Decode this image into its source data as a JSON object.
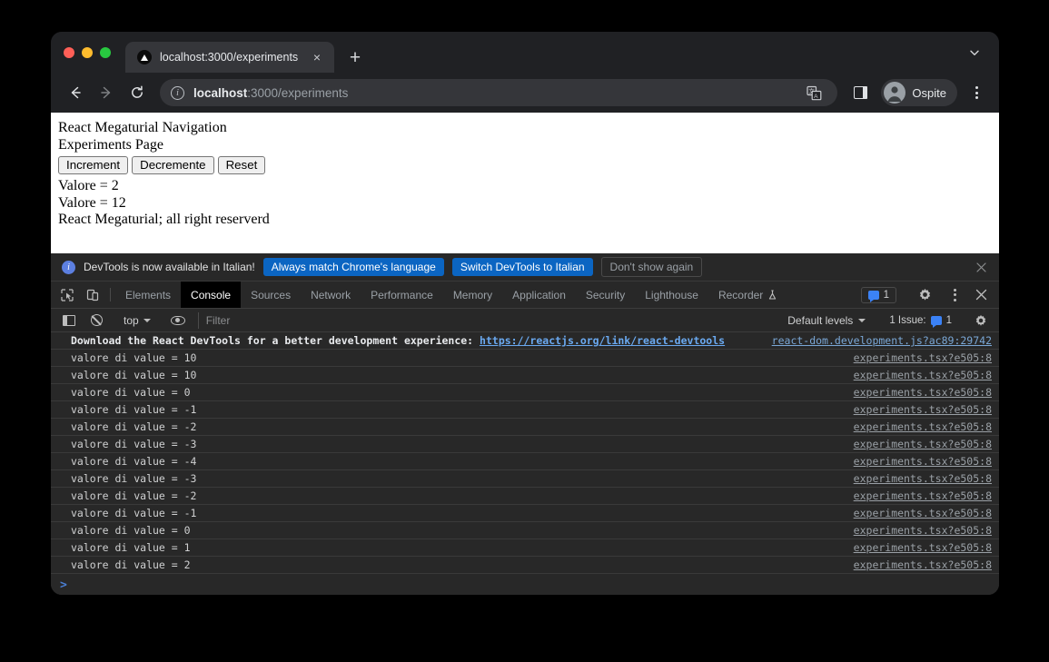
{
  "browser": {
    "tab": {
      "title": "localhost:3000/experiments",
      "favicon": "nextjs-triangle-icon",
      "close_label": "×"
    },
    "new_tab_label": "+",
    "tab_list_icon": "chevron-down-icon",
    "nav": {
      "back": "←",
      "forward": "→",
      "reload": "⟳"
    },
    "omnibox": {
      "site_info_icon": "info-icon",
      "url_host": "localhost",
      "url_rest": ":3000/experiments",
      "full_url": "localhost:3000/experiments"
    },
    "translate_icon": "translate-icon",
    "side_panel_icon": "side-panel-icon",
    "profile": {
      "name": "Ospite",
      "avatar_icon": "person-avatar-icon"
    },
    "menu_icon": "kebab-menu-icon"
  },
  "page": {
    "heading": "React Megaturial Navigation",
    "subheading": "Experiments Page",
    "buttons": [
      {
        "label": "Increment"
      },
      {
        "label": "Decremente"
      },
      {
        "label": "Reset"
      }
    ],
    "values": [
      "Valore = 2",
      "Valore = 12"
    ],
    "footer": "React Megaturial; all right reserverd"
  },
  "devtools": {
    "banner": {
      "icon": "info-icon",
      "text": "DevTools is now available in Italian!",
      "primary_button": "Always match Chrome's language",
      "secondary_button": "Switch DevTools to Italian",
      "dismiss_button": "Don't show again",
      "close_icon": "close-icon"
    },
    "inspect_icon": "inspect-cursor-icon",
    "device_icon": "device-toolbar-icon",
    "tabs": [
      {
        "label": "Elements",
        "active": false
      },
      {
        "label": "Console",
        "active": true
      },
      {
        "label": "Sources",
        "active": false
      },
      {
        "label": "Network",
        "active": false
      },
      {
        "label": "Performance",
        "active": false
      },
      {
        "label": "Memory",
        "active": false
      },
      {
        "label": "Application",
        "active": false
      },
      {
        "label": "Security",
        "active": false
      },
      {
        "label": "Lighthouse",
        "active": false
      },
      {
        "label": "Recorder",
        "active": false
      }
    ],
    "recorder_badge_icon": "experiment-flask-icon",
    "issues_chip": {
      "icon": "issue-message-icon",
      "count": "1"
    },
    "settings_icon": "gear-icon",
    "more_icon": "kebab-menu-icon",
    "close_icon": "close-icon",
    "toolbar": {
      "sidebar_icon": "console-sidebar-icon",
      "clear_icon": "clear-console-icon",
      "context": "top",
      "context_caret_icon": "chevron-down-icon",
      "live_expression_icon": "eye-icon",
      "filter_placeholder": "Filter",
      "levels_label": "Default levels",
      "levels_caret_icon": "chevron-down-icon",
      "issues_label": "1 Issue:",
      "issues_count": "1",
      "issues_icon": "issue-message-icon",
      "settings_icon": "gear-icon"
    },
    "console": {
      "prompt_symbol": ">",
      "messages": [
        {
          "type": "info",
          "text": "Download the React DevTools for a better development experience: ",
          "url": "https://reactjs.org/link/react-devtools",
          "source": "react-dom.development.js?ac89:29742"
        },
        {
          "type": "log",
          "text": "valore di value = 10",
          "source": "experiments.tsx?e505:8"
        },
        {
          "type": "log",
          "text": "valore di value = 10",
          "source": "experiments.tsx?e505:8"
        },
        {
          "type": "log",
          "text": "valore di value = 0",
          "source": "experiments.tsx?e505:8"
        },
        {
          "type": "log",
          "text": "valore di value = -1",
          "source": "experiments.tsx?e505:8"
        },
        {
          "type": "log",
          "text": "valore di value = -2",
          "source": "experiments.tsx?e505:8"
        },
        {
          "type": "log",
          "text": "valore di value = -3",
          "source": "experiments.tsx?e505:8"
        },
        {
          "type": "log",
          "text": "valore di value = -4",
          "source": "experiments.tsx?e505:8"
        },
        {
          "type": "log",
          "text": "valore di value = -3",
          "source": "experiments.tsx?e505:8"
        },
        {
          "type": "log",
          "text": "valore di value = -2",
          "source": "experiments.tsx?e505:8"
        },
        {
          "type": "log",
          "text": "valore di value = -1",
          "source": "experiments.tsx?e505:8"
        },
        {
          "type": "log",
          "text": "valore di value = 0",
          "source": "experiments.tsx?e505:8"
        },
        {
          "type": "log",
          "text": "valore di value = 1",
          "source": "experiments.tsx?e505:8"
        },
        {
          "type": "log",
          "text": "valore di value = 2",
          "source": "experiments.tsx?e505:8"
        }
      ]
    }
  },
  "colors": {
    "accent_blue": "#0b65c2",
    "link_blue": "#6aa9f0",
    "devtools_bg": "#282828",
    "chrome_bg": "#202124",
    "page_bg": "#ffffff"
  }
}
